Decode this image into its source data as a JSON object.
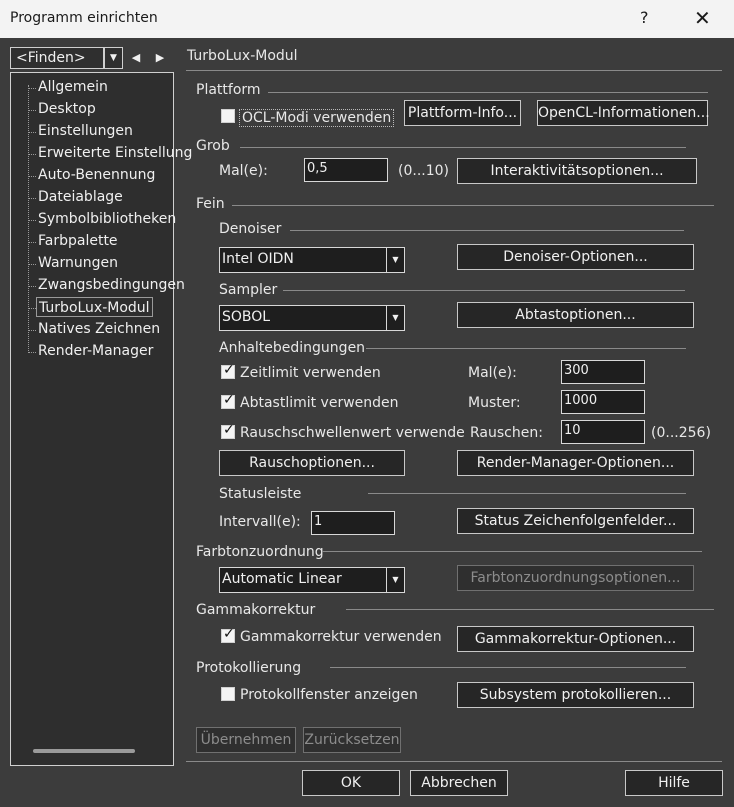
{
  "window": {
    "title": "Programm einrichten",
    "help_glyph": "?",
    "close_glyph": "✕"
  },
  "finder": {
    "value": "<Finden>",
    "dropdown_glyph": "▼",
    "prev_glyph": "◀",
    "next_glyph": "▶"
  },
  "tree": {
    "items": [
      "Allgemein",
      "Desktop",
      "Einstellungen",
      "Erweiterte Einstellung",
      "Auto-Benennung",
      "Dateiablage",
      "Symbolbibliotheken",
      "Farbpalette",
      "Warnungen",
      "Zwangsbedingungen",
      "TurboLux-Modul",
      "Natives Zeichnen",
      "Render-Manager"
    ],
    "selected_index": 10
  },
  "panel_title": "TurboLux-Modul",
  "plattform": {
    "heading": "Plattform",
    "ocl_label": "OCL-Modi verwenden",
    "ocl_checked": false,
    "info_button": "Plattform-Info...",
    "opencl_button": "OpenCL-Informationen..."
  },
  "grob": {
    "heading": "Grob",
    "times_label": "Mal(e):",
    "times_value": "0,5",
    "range": "(0...10)",
    "interactive_button": "Interaktivitätsoptionen..."
  },
  "fein": {
    "heading": "Fein",
    "denoiser": {
      "heading": "Denoiser",
      "value": "Intel OIDN",
      "button": "Denoiser-Optionen..."
    },
    "sampler": {
      "heading": "Sampler",
      "value": "SOBOL",
      "button": "Abtastoptionen..."
    },
    "halt": {
      "heading": "Anhaltebedingungen",
      "time_label": "Zeitlimit verwenden",
      "time_checked": true,
      "times_label": "Mal(e):",
      "times_value": "300",
      "sample_label": "Abtastlimit verwenden",
      "sample_checked": true,
      "pattern_label": "Muster:",
      "pattern_value": "1000",
      "noise_label": "Rauschschwellenwert verwende",
      "noise_checked": true,
      "noise_value_label": "Rauschen:",
      "noise_value": "10",
      "noise_range": "(0...256)",
      "noise_button": "Rauschoptionen...",
      "render_button": "Render-Manager-Optionen..."
    },
    "status": {
      "heading": "Statusleiste",
      "interval_label": "Intervall(e):",
      "interval_value": "1",
      "button": "Status Zeichenfolgenfelder..."
    }
  },
  "tonemap": {
    "heading": "Farbtonzuordnung",
    "value": "Automatic Linear",
    "button": "Farbtonzuordnungsoptionen..."
  },
  "gamma": {
    "heading": "Gammakorrektur",
    "label": "Gammakorrektur verwenden",
    "checked": true,
    "button": "Gammakorrektur-Optionen..."
  },
  "log": {
    "heading": "Protokollierung",
    "label": "Protokollfenster anzeigen",
    "checked": false,
    "button": "Subsystem protokollieren..."
  },
  "apply_button": "Übernehmen",
  "reset_button": "Zurücksetzen",
  "footer": {
    "ok": "OK",
    "cancel": "Abbrechen",
    "help": "Hilfe"
  }
}
